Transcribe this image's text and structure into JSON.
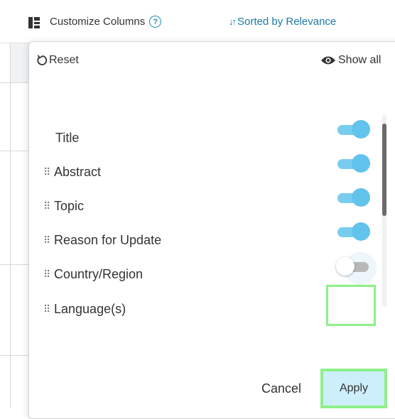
{
  "toolbar": {
    "customize_label": "Customize Columns",
    "help_icon": "?",
    "sort_label": "Sorted by Relevance"
  },
  "panel": {
    "reset_label": "Reset",
    "show_all_label": "Show all",
    "columns": [
      {
        "label": "Title",
        "draggable": false,
        "enabled": null
      },
      {
        "label": "Abstract",
        "draggable": true,
        "enabled": true
      },
      {
        "label": "Topic",
        "draggable": true,
        "enabled": true
      },
      {
        "label": "Reason for Update",
        "draggable": true,
        "enabled": true
      },
      {
        "label": "Country/Region",
        "draggable": true,
        "enabled": true
      },
      {
        "label": "Language(s)",
        "draggable": true,
        "enabled": false
      }
    ],
    "cancel_label": "Cancel",
    "apply_label": "Apply"
  },
  "colors": {
    "accent": "#1a7aa6",
    "toggle_on": "#62c3ec",
    "highlight": "#8ef08a",
    "apply_bg": "#cdeefb"
  },
  "icons": {
    "columns_icon": "columns-icon",
    "sort_icon": "sort-arrows-icon",
    "reset_icon": "reset-arrow-icon",
    "show_all_icon": "eye-icon",
    "grip_icon": "drag-handle-icon"
  }
}
